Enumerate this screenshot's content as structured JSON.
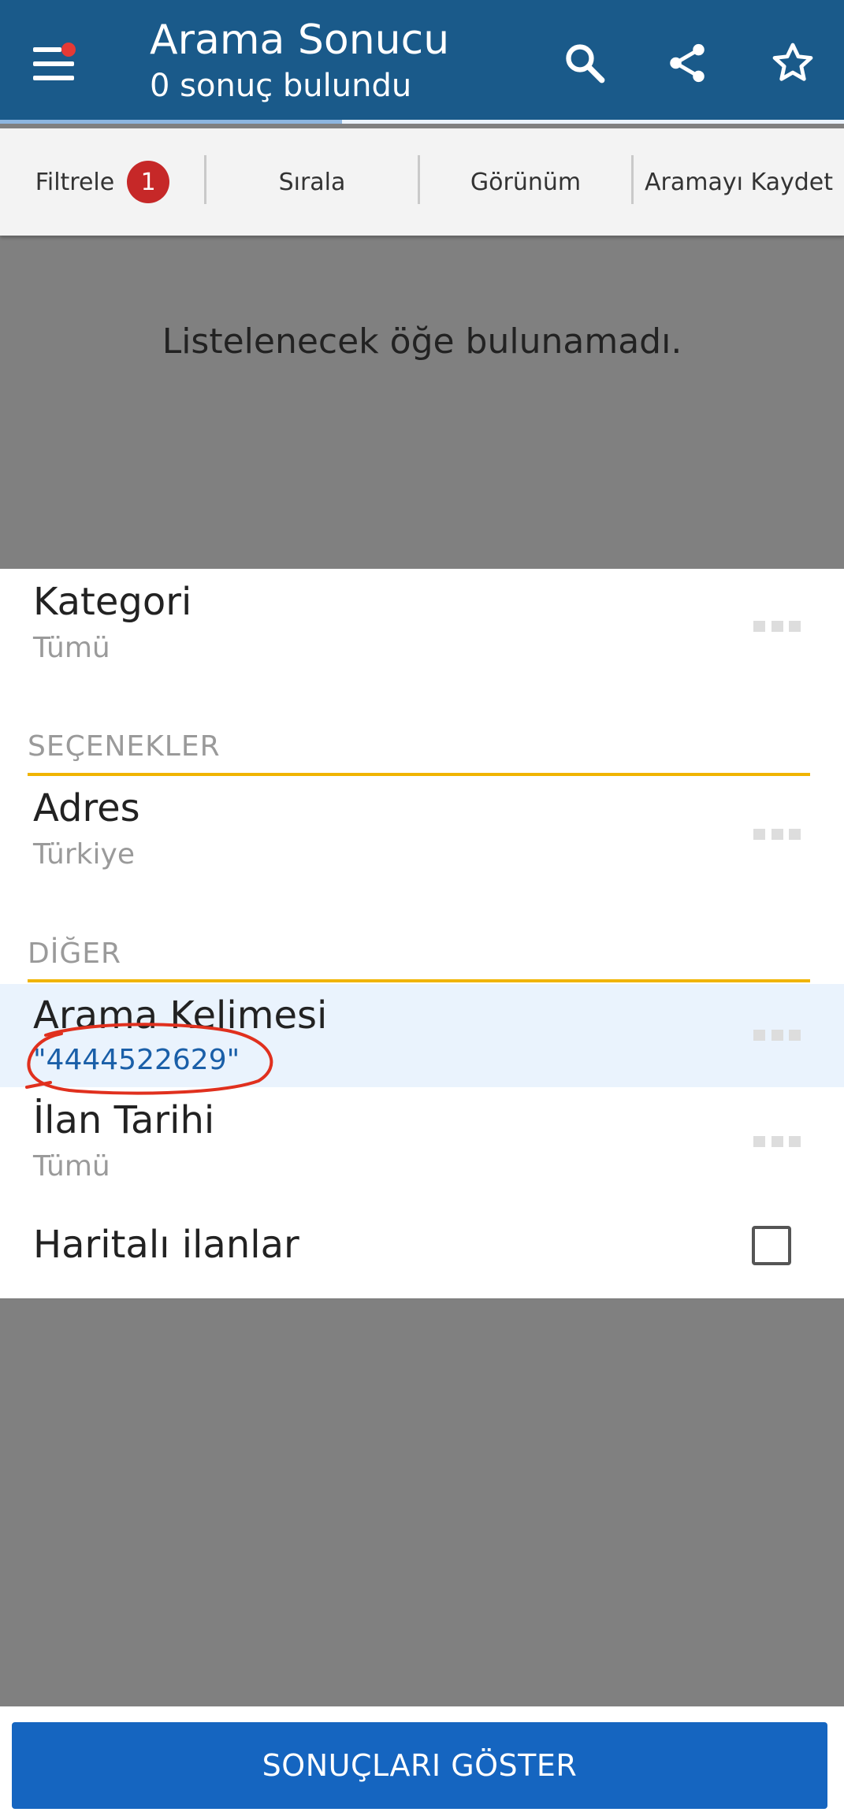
{
  "header": {
    "title": "Arama Sonucu",
    "subtitle": "0 sonuç bulundu",
    "progress": 0.405,
    "icons": [
      "menu-icon",
      "search-icon",
      "share-icon",
      "star-icon"
    ],
    "colors": {
      "appbar": "#1a5a8a",
      "notification_dot": "#e53935"
    }
  },
  "toolbar": {
    "filter_label": "Filtrele",
    "filter_count": "1",
    "sort_label": "Sırala",
    "view_label": "Görünüm",
    "save_search_label": "Aramayı Kaydet"
  },
  "results": {
    "empty_message": "Listelenecek öğe bulunamadı."
  },
  "filters": {
    "category": {
      "label": "Kategori",
      "value": "Tümü"
    },
    "options_header": "SEÇENEKLER",
    "address": {
      "label": "Adres",
      "value": "Türkiye"
    },
    "other_header": "DİĞER",
    "keyword": {
      "label": "Arama Kelimesi",
      "value": "\"4444522629\""
    },
    "date": {
      "label": "İlan Tarihi",
      "value": "Tümü"
    },
    "map_listings": {
      "label": "Haritalı ilanlar",
      "checked": false
    }
  },
  "footer": {
    "show_results_label": "SONUÇLARI GÖSTER",
    "colors": {
      "button": "#1565c0"
    }
  }
}
